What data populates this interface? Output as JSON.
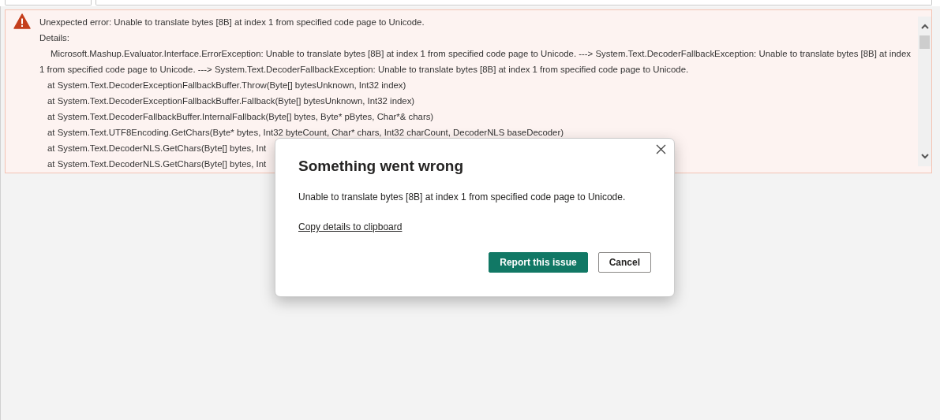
{
  "error_panel": {
    "title": "Unexpected error: Unable to translate bytes [8B] at index 1 from specified code page to Unicode.",
    "details_label": "Details:",
    "message": "Microsoft.Mashup.Evaluator.Interface.ErrorException: Unable to translate bytes [8B] at index 1 from specified code page to Unicode. ---> System.Text.DecoderFallbackException: Unable to translate bytes [8B] at index 1 from specified code page to Unicode. ---> System.Text.DecoderFallbackException: Unable to translate bytes [8B] at index 1 from specified code page to Unicode.",
    "stack": [
      "at System.Text.DecoderExceptionFallbackBuffer.Throw(Byte[] bytesUnknown, Int32 index)",
      "at System.Text.DecoderExceptionFallbackBuffer.Fallback(Byte[] bytesUnknown, Int32 index)",
      "at System.Text.DecoderFallbackBuffer.InternalFallback(Byte[] bytes, Byte* pBytes, Char*& chars)",
      "at System.Text.UTF8Encoding.GetChars(Byte* bytes, Int32 byteCount, Char* chars, Int32 charCount, DecoderNLS baseDecoder)",
      "at System.Text.DecoderNLS.GetChars(Byte[] bytes, Int",
      "at System.Text.DecoderNLS.GetChars(Byte[] bytes, Int"
    ]
  },
  "dialog": {
    "title": "Something went wrong",
    "message": "Unable to translate bytes [8B] at index 1 from specified code page to Unicode.",
    "link": "Copy details to clipboard",
    "buttons": [
      {
        "label": "Report this issue",
        "kind": "primary"
      },
      {
        "label": "Cancel",
        "kind": "secondary"
      }
    ]
  }
}
